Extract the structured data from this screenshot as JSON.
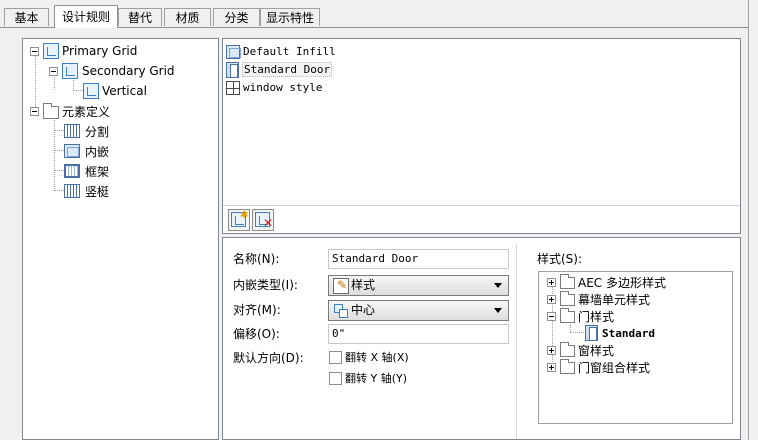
{
  "tabs": [
    "基本",
    "设计规则",
    "替代",
    "材质",
    "分类",
    "显示特性"
  ],
  "active_tab": "设计规则",
  "rule_tree": {
    "primary": "Primary Grid",
    "secondary": "Secondary Grid",
    "vertical": "Vertical",
    "element_def": "元素定义",
    "children": [
      "分割",
      "内嵌",
      "框架",
      "竖梃"
    ]
  },
  "infill_list": [
    "Default Infill",
    "Standard Door",
    "window style"
  ],
  "selected_infill": "Standard Door",
  "props": {
    "name_label": "名称(N):",
    "name_value": "Standard Door",
    "infill_type_label": "内嵌类型(I):",
    "infill_type_value": "样式",
    "align_label": "对齐(M):",
    "align_value": "中心",
    "offset_label": "偏移(O):",
    "offset_value": "0\"",
    "orientation_label": "默认方向(D):",
    "flip_x_label": "翻转 X 轴(X)",
    "flip_y_label": "翻转 Y 轴(Y)",
    "flip_x_checked": false,
    "flip_y_checked": false
  },
  "styles": {
    "label": "样式(S):",
    "items": [
      "AEC 多边形样式",
      "幕墙单元样式",
      "门样式",
      "Standard",
      "窗样式",
      "门窗组合样式"
    ]
  },
  "icons": {
    "add_button": "new-item-icon",
    "delete_button": "delete-item-icon"
  },
  "colors": {
    "accent": "#3d7fc1",
    "delete": "#d02020"
  }
}
